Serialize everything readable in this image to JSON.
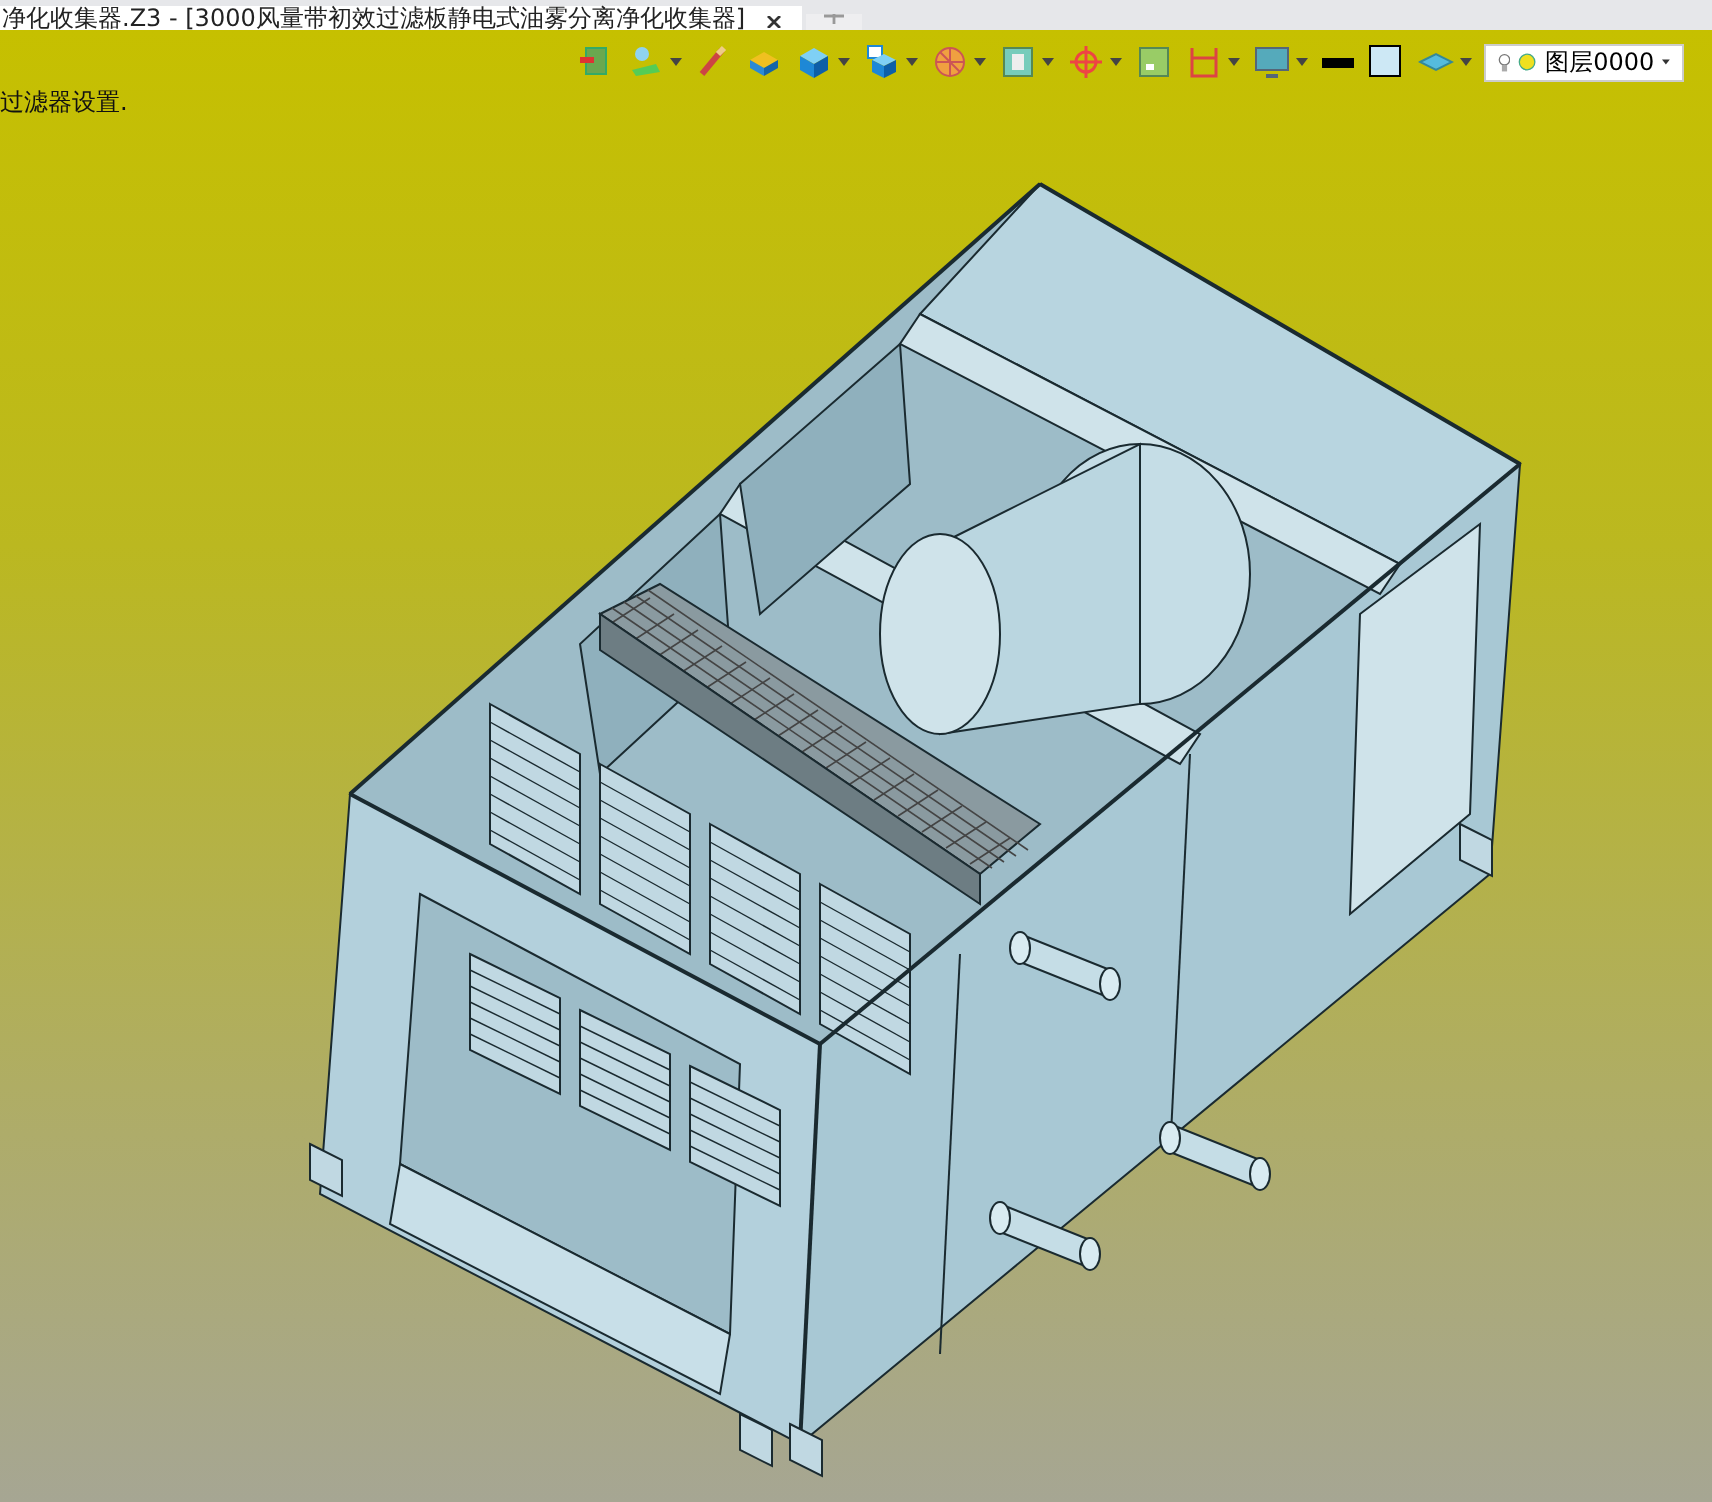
{
  "document_tab": {
    "title": "净化收集器.Z3 - [3000风量带初效过滤板静电式油雾分离净化收集器]",
    "selected": true
  },
  "command_prompt": "过滤器设置.",
  "layer_selector": {
    "value": "图层0000"
  }
}
